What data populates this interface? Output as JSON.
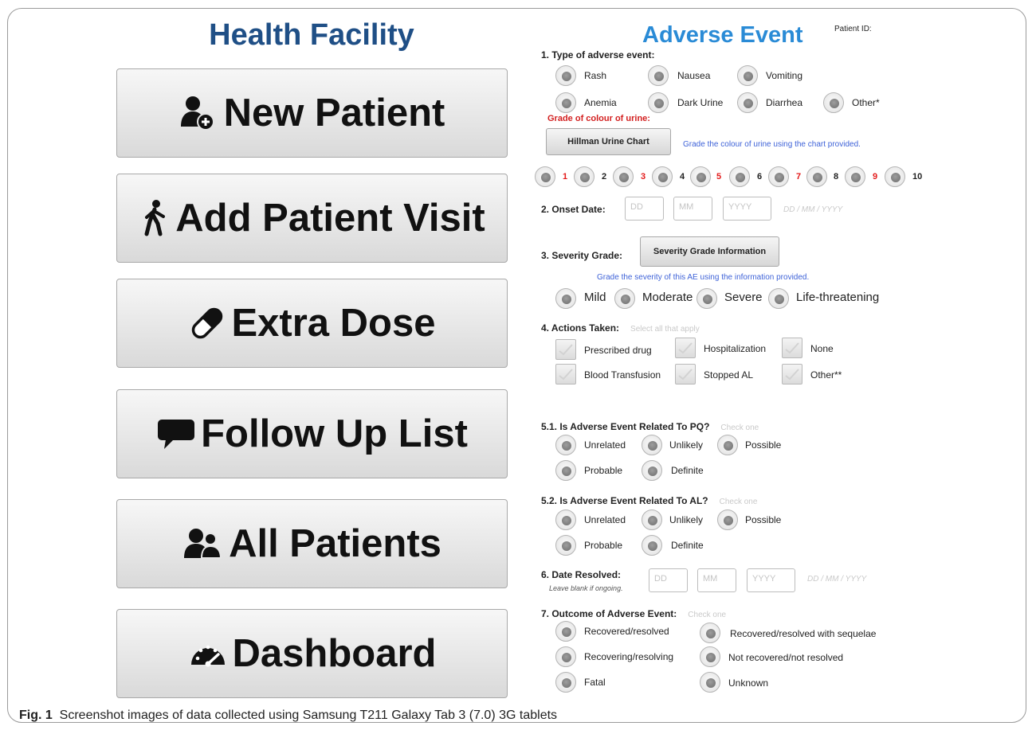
{
  "left": {
    "title": "Health Facility",
    "buttons": [
      {
        "label": "New Patient",
        "icon": "add-user-icon"
      },
      {
        "label": "Add Patient Visit",
        "icon": "walking-person-icon"
      },
      {
        "label": "Extra Dose",
        "icon": "pill-icon"
      },
      {
        "label": "Follow Up List",
        "icon": "speech-bubble-icon"
      },
      {
        "label": "All Patients",
        "icon": "users-icon"
      },
      {
        "label": "Dashboard",
        "icon": "speedometer-icon"
      }
    ]
  },
  "form": {
    "title": "Adverse Event",
    "patient_id_label": "Patient ID:",
    "q1": {
      "label": "1. Type of adverse event:",
      "options": [
        "Rash",
        "Nausea",
        "Vomiting",
        "Anemia",
        "Dark Urine",
        "Diarrhea",
        "Other*"
      ]
    },
    "urine": {
      "label": "Grade of colour of urine:",
      "chart_button": "Hillman Urine Chart",
      "hint": "Grade the colour of urine using the chart provided.",
      "grades": [
        "1",
        "2",
        "3",
        "4",
        "5",
        "6",
        "7",
        "8",
        "9",
        "10"
      ]
    },
    "q2": {
      "label": "2. Onset Date:",
      "dd": "DD",
      "mm": "MM",
      "yyyy": "YYYY",
      "format": "DD / MM / YYYY"
    },
    "q3": {
      "label": "3. Severity Grade:",
      "info_button": "Severity Grade Information",
      "hint": "Grade the severity of this AE using the information provided.",
      "options": [
        "Mild",
        "Moderate",
        "Severe",
        "Life-threatening"
      ]
    },
    "q4": {
      "label": "4. Actions Taken:",
      "hint": "Select all that apply",
      "options": [
        "Prescribed drug",
        "Hospitalization",
        "None",
        "Blood Transfusion",
        "Stopped AL",
        "Other**"
      ]
    },
    "q51": {
      "label": "5.1. Is Adverse Event Related To PQ?",
      "hint": "Check one",
      "options": [
        "Unrelated",
        "Unlikely",
        "Possible",
        "Probable",
        "Definite"
      ]
    },
    "q52": {
      "label": "5.2. Is Adverse Event Related To AL?",
      "hint": "Check one",
      "options": [
        "Unrelated",
        "Unlikely",
        "Possible",
        "Probable",
        "Definite"
      ]
    },
    "q6": {
      "label": "6. Date Resolved:",
      "sub": "Leave blank if ongoing.",
      "dd": "DD",
      "mm": "MM",
      "yyyy": "YYYY",
      "format": "DD / MM / YYYY"
    },
    "q7": {
      "label": "7. Outcome of Adverse Event:",
      "hint": "Check one",
      "options": [
        "Recovered/resolved",
        "Recovered/resolved with sequelae",
        "Recovering/resolving",
        "Not recovered/not resolved",
        "Fatal",
        "Unknown"
      ]
    }
  },
  "caption": {
    "label": "Fig. 1",
    "text": "Screenshot images of data collected using Samsung T211 Galaxy Tab 3 (7.0) 3G tablets"
  },
  "colors": {
    "left_title": "#1f4f86",
    "form_title": "#2a8bd6",
    "red_text": "#e31b1b",
    "hint_blue": "#3f63d8"
  }
}
